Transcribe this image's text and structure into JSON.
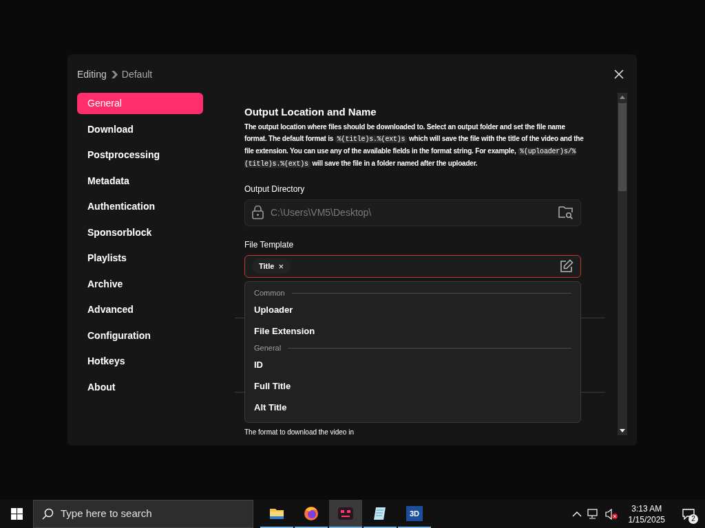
{
  "breadcrumb": {
    "parent": "Editing",
    "current": "Default"
  },
  "sidebar": {
    "items": [
      {
        "label": "General",
        "selected": true
      },
      {
        "label": "Download",
        "selected": false
      },
      {
        "label": "Postprocessing",
        "selected": false
      },
      {
        "label": "Metadata",
        "selected": false
      },
      {
        "label": "Authentication",
        "selected": false
      },
      {
        "label": "Sponsorblock",
        "selected": false
      },
      {
        "label": "Playlists",
        "selected": false
      },
      {
        "label": "Archive",
        "selected": false
      },
      {
        "label": "Advanced",
        "selected": false
      },
      {
        "label": "Configuration",
        "selected": false
      },
      {
        "label": "Hotkeys",
        "selected": false
      },
      {
        "label": "About",
        "selected": false
      }
    ]
  },
  "section": {
    "title": "Output Location and Name",
    "description": [
      {
        "kind": "text",
        "text": "The output location where files should be downloaded to. Select an output folder and set the file name format. The default format is "
      },
      {
        "kind": "code",
        "text": "%(title)s.%(ext)s"
      },
      {
        "kind": "text",
        "text": " which will save the file with the title of the video and the file extension. You can use any of the available fields in the format string. For example, "
      },
      {
        "kind": "code",
        "text": "%(uploader)s/%(title)s.%(ext)s"
      },
      {
        "kind": "text",
        "text": " will save the file in a folder named after the uploader."
      }
    ]
  },
  "output_directory": {
    "label": "Output Directory",
    "value": "C:\\Users\\VM5\\Desktop\\",
    "locked": true
  },
  "file_template": {
    "label": "File Template",
    "focused": true,
    "tokens": [
      {
        "label": "Title",
        "remove": "×"
      }
    ]
  },
  "dropdown": {
    "groups": [
      {
        "header": "Common",
        "items": [
          {
            "label": "Uploader"
          },
          {
            "label": "File Extension"
          }
        ]
      },
      {
        "header": "General",
        "items": [
          {
            "label": "ID"
          },
          {
            "label": "Full Title"
          },
          {
            "label": "Alt Title"
          }
        ]
      }
    ]
  },
  "next_hint": "The format to download the video in",
  "taskbar": {
    "search_placeholder": "Type here to search",
    "apps": [
      {
        "kind": "folder",
        "selected": false
      },
      {
        "kind": "firefox",
        "selected": false
      },
      {
        "kind": "robot",
        "selected": true
      },
      {
        "kind": "notepad",
        "selected": false
      },
      {
        "kind": "viewer3d",
        "label": "3D",
        "selected": false
      }
    ],
    "time": "3:13 AM",
    "date": "1/15/2025",
    "notifications": "2"
  }
}
